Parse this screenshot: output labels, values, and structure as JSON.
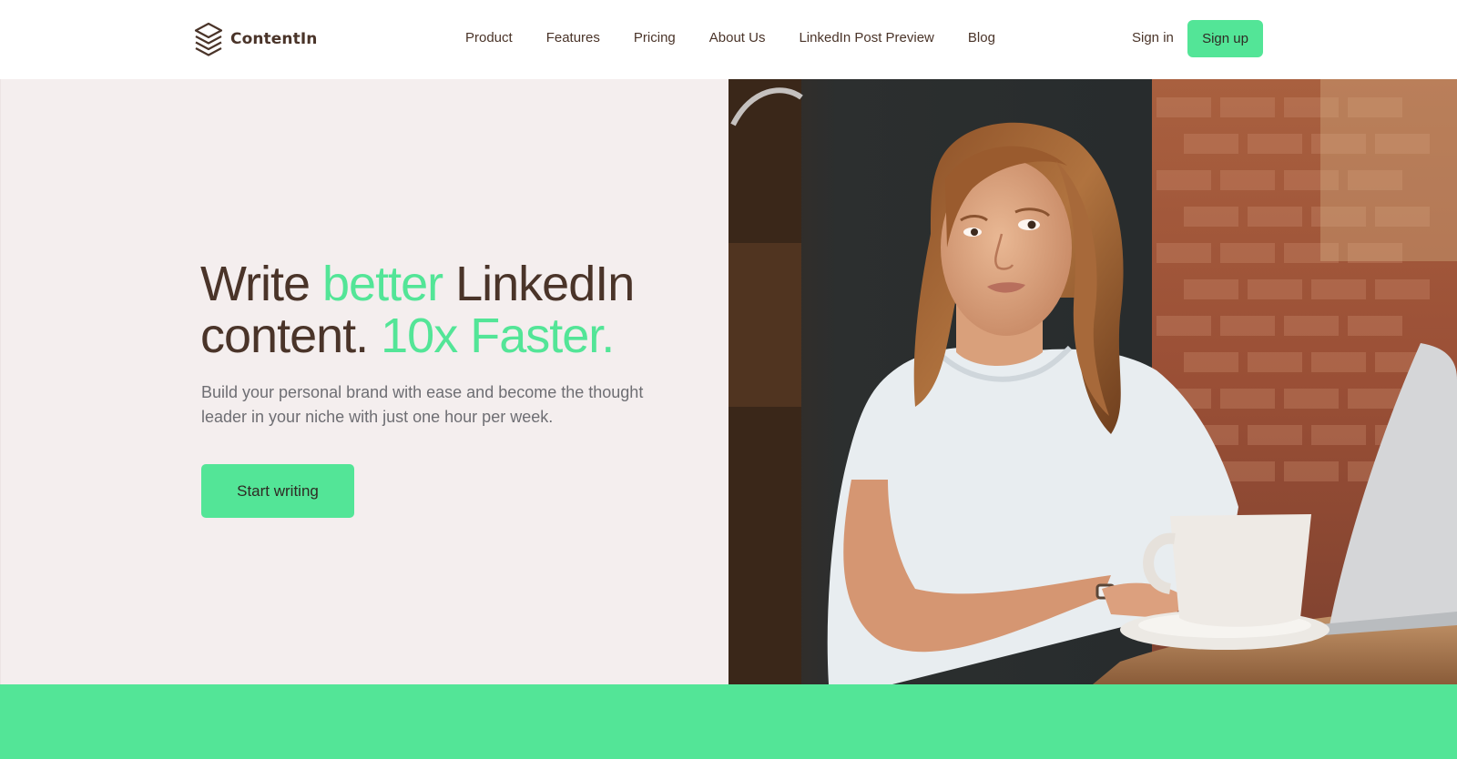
{
  "brand": {
    "name": "ContentIn"
  },
  "nav": {
    "items": [
      {
        "label": "Product"
      },
      {
        "label": "Features"
      },
      {
        "label": "Pricing"
      },
      {
        "label": "About Us"
      },
      {
        "label": "LinkedIn Post Preview"
      },
      {
        "label": "Blog"
      }
    ]
  },
  "auth": {
    "signin_label": "Sign in",
    "signup_label": "Sign up"
  },
  "hero": {
    "headline_part1": "Write ",
    "headline_accent1": "better",
    "headline_part2": " LinkedIn content. ",
    "headline_accent2": "10x Faster.",
    "subtext": "Build your personal brand with ease and become the thought leader in your niche with just one hour per week.",
    "cta_label": "Start writing"
  },
  "colors": {
    "accent": "#53e597",
    "text_dark": "#4a3429",
    "hero_bg": "#f4eeee",
    "muted": "#6e6e73"
  }
}
